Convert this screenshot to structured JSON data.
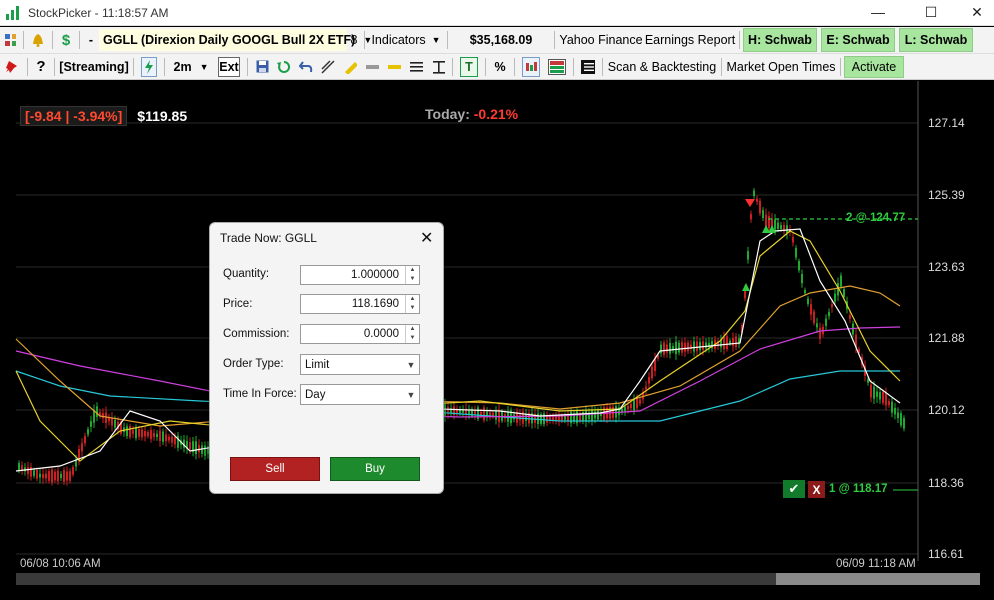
{
  "window": {
    "title": "StockPicker - 11:18:57 AM",
    "minimize": "—",
    "maximize": "☐",
    "close": "✕"
  },
  "toolbar1": {
    "dash": "-",
    "symbol": "GGLL (Direxion Daily GOOGL Bull 2X ETF)",
    "symbol_count": "8",
    "indicators": "Indicators",
    "balance": "$35,168.09",
    "yahoo": "Yahoo Finance",
    "earnings": "Earnings Report",
    "h_schwab": "H: Schwab",
    "e_schwab": "E: Schwab",
    "l_schwab": "L: Schwab"
  },
  "toolbar2": {
    "streaming": "[Streaming]",
    "interval": "2m",
    "ext": "Ext",
    "t_label": "T",
    "percent": "%",
    "scan": "Scan & Backtesting",
    "market_open": "Market Open Times",
    "activate": "Activate"
  },
  "chart": {
    "change": "[-9.84 | -3.94%]",
    "last_price": "$119.85",
    "today_label": "Today:",
    "today_value": "-0.21%",
    "yticks": [
      "127.14",
      "125.39",
      "123.63",
      "121.88",
      "120.12",
      "118.36",
      "116.61"
    ],
    "x_start": "06/08 10:06 AM",
    "x_end": "06/09 11:18 AM",
    "position_label": "2 @ 124.77",
    "order_label": "1 @ 118.17",
    "order_check": "✔",
    "order_cancel": "X",
    "colors": {
      "up": "#1faa2f",
      "down": "#cc1f1f",
      "ma_white": "#ffffff",
      "ma_yellow": "#e6d22a",
      "ma_orange": "#e0a030",
      "ma_magenta": "#d040e0",
      "ma_cyan": "#28c8d8"
    }
  },
  "dialog": {
    "title": "Trade Now: GGLL",
    "close": "✕",
    "quantity_label": "Quantity:",
    "quantity": "1.000000",
    "price_label": "Price:",
    "price": "118.1690",
    "commission_label": "Commission:",
    "commission": "0.0000",
    "order_type_label": "Order Type:",
    "order_type": "Limit",
    "tif_label": "Time In Force:",
    "tif": "Day",
    "sell": "Sell",
    "buy": "Buy"
  }
}
